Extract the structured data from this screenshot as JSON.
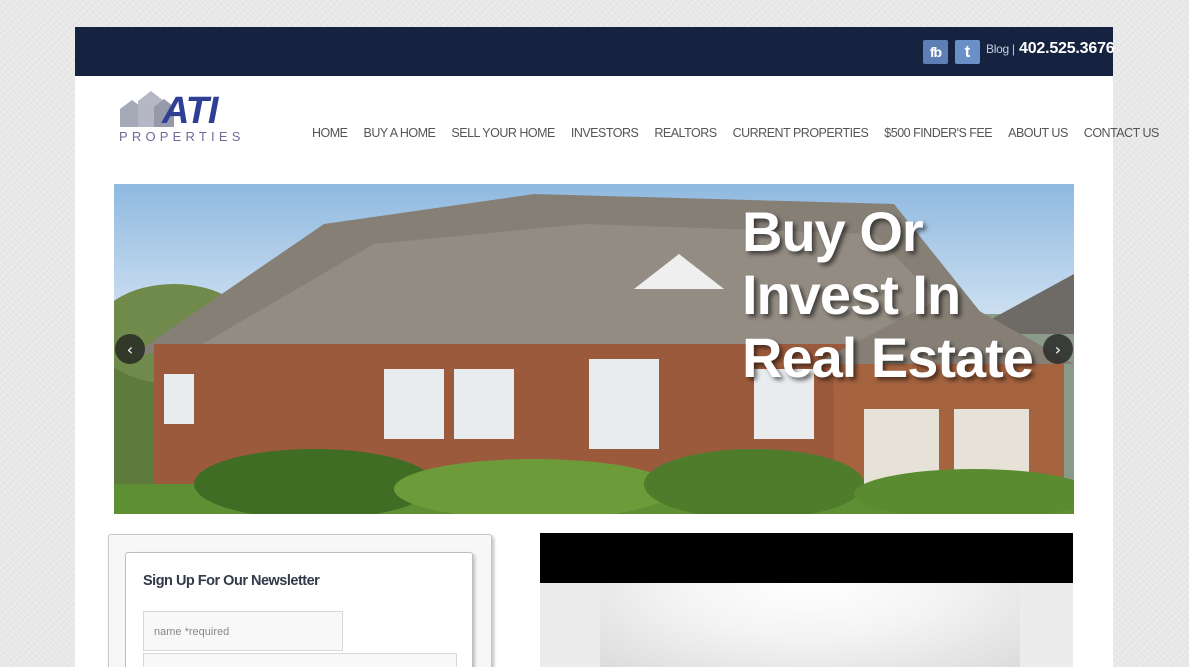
{
  "header": {
    "fb_icon": "fb",
    "twitter_icon": "t",
    "blog_label": "Blog |",
    "phone": "402.525.3676"
  },
  "logo": {
    "name": "ATI",
    "sub": "PROPERTIES"
  },
  "nav": [
    "HOME",
    "BUY A HOME",
    "SELL YOUR HOME",
    "INVESTORS",
    "REALTORS",
    "CURRENT PROPERTIES",
    "$500 FINDER'S FEE",
    "ABOUT US",
    "CONTACT US"
  ],
  "hero": {
    "line1": "Buy Or Invest In",
    "line2": "Real Estate",
    "prev_icon": "‹",
    "next_icon": "›"
  },
  "newsletter": {
    "title": "Sign Up For Our Newsletter",
    "name_placeholder": "name *required"
  },
  "colors": {
    "topbar": "#152240",
    "logo": "#2f3f93"
  }
}
